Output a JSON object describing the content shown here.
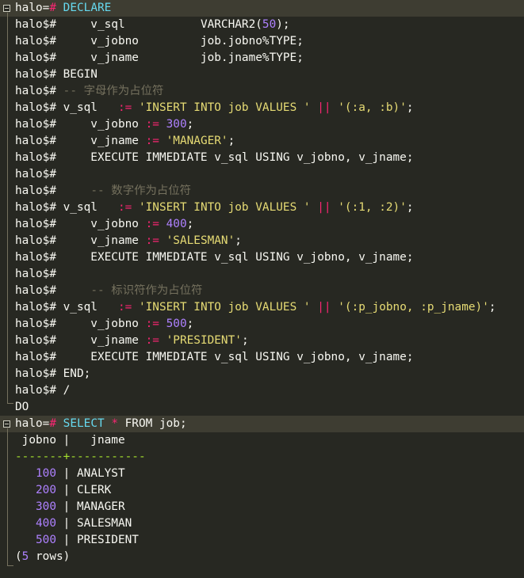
{
  "terminal": {
    "lines": [
      [
        {
          "t": "halo=",
          "c": ""
        },
        {
          "t": "#",
          "c": "op"
        },
        {
          "t": " DECLARE",
          "c": "kw"
        }
      ],
      [
        {
          "t": "halo$#     v_sql           ",
          "c": ""
        },
        {
          "t": "VARCHAR2(",
          "c": ""
        },
        {
          "t": "50",
          "c": "num"
        },
        {
          "t": ");",
          "c": ""
        }
      ],
      [
        {
          "t": "halo$#     v_jobno         job.jobno%TYPE;",
          "c": ""
        }
      ],
      [
        {
          "t": "halo$#     v_jname         job.jname%TYPE;",
          "c": ""
        }
      ],
      [
        {
          "t": "halo$# BEGIN",
          "c": ""
        }
      ],
      [
        {
          "t": "halo$# ",
          "c": ""
        },
        {
          "t": "-- 字母作为占位符",
          "c": "com"
        }
      ],
      [
        {
          "t": "halo$# v_sql   ",
          "c": ""
        },
        {
          "t": ":=",
          "c": "op"
        },
        {
          "t": " ",
          "c": ""
        },
        {
          "t": "'INSERT INTO job VALUES '",
          "c": "str"
        },
        {
          "t": " ",
          "c": ""
        },
        {
          "t": "||",
          "c": "op"
        },
        {
          "t": " ",
          "c": ""
        },
        {
          "t": "'(:a, :b)'",
          "c": "str"
        },
        {
          "t": ";",
          "c": ""
        }
      ],
      [
        {
          "t": "halo$#     v_jobno ",
          "c": ""
        },
        {
          "t": ":=",
          "c": "op"
        },
        {
          "t": " ",
          "c": ""
        },
        {
          "t": "300",
          "c": "num"
        },
        {
          "t": ";",
          "c": ""
        }
      ],
      [
        {
          "t": "halo$#     v_jname ",
          "c": ""
        },
        {
          "t": ":=",
          "c": "op"
        },
        {
          "t": " ",
          "c": ""
        },
        {
          "t": "'MANAGER'",
          "c": "str"
        },
        {
          "t": ";",
          "c": ""
        }
      ],
      [
        {
          "t": "halo$#     EXECUTE IMMEDIATE v_sql USING v_jobno, v_jname;",
          "c": ""
        }
      ],
      [
        {
          "t": "halo$#",
          "c": ""
        }
      ],
      [
        {
          "t": "halo$#     ",
          "c": ""
        },
        {
          "t": "-- 数字作为占位符",
          "c": "com"
        }
      ],
      [
        {
          "t": "halo$# v_sql   ",
          "c": ""
        },
        {
          "t": ":=",
          "c": "op"
        },
        {
          "t": " ",
          "c": ""
        },
        {
          "t": "'INSERT INTO job VALUES '",
          "c": "str"
        },
        {
          "t": " ",
          "c": ""
        },
        {
          "t": "||",
          "c": "op"
        },
        {
          "t": " ",
          "c": ""
        },
        {
          "t": "'(:1, :2)'",
          "c": "str"
        },
        {
          "t": ";",
          "c": ""
        }
      ],
      [
        {
          "t": "halo$#     v_jobno ",
          "c": ""
        },
        {
          "t": ":=",
          "c": "op"
        },
        {
          "t": " ",
          "c": ""
        },
        {
          "t": "400",
          "c": "num"
        },
        {
          "t": ";",
          "c": ""
        }
      ],
      [
        {
          "t": "halo$#     v_jname ",
          "c": ""
        },
        {
          "t": ":=",
          "c": "op"
        },
        {
          "t": " ",
          "c": ""
        },
        {
          "t": "'SALESMAN'",
          "c": "str"
        },
        {
          "t": ";",
          "c": ""
        }
      ],
      [
        {
          "t": "halo$#     EXECUTE IMMEDIATE v_sql USING v_jobno, v_jname;",
          "c": ""
        }
      ],
      [
        {
          "t": "halo$#",
          "c": ""
        }
      ],
      [
        {
          "t": "halo$#     ",
          "c": ""
        },
        {
          "t": "-- 标识符作为占位符",
          "c": "com"
        }
      ],
      [
        {
          "t": "halo$# v_sql   ",
          "c": ""
        },
        {
          "t": ":=",
          "c": "op"
        },
        {
          "t": " ",
          "c": ""
        },
        {
          "t": "'INSERT INTO job VALUES '",
          "c": "str"
        },
        {
          "t": " ",
          "c": ""
        },
        {
          "t": "||",
          "c": "op"
        },
        {
          "t": " ",
          "c": ""
        },
        {
          "t": "'(:p_jobno, :p_jname)'",
          "c": "str"
        },
        {
          "t": ";",
          "c": ""
        }
      ],
      [
        {
          "t": "halo$#     v_jobno ",
          "c": ""
        },
        {
          "t": ":=",
          "c": "op"
        },
        {
          "t": " ",
          "c": ""
        },
        {
          "t": "500",
          "c": "num"
        },
        {
          "t": ";",
          "c": ""
        }
      ],
      [
        {
          "t": "halo$#     v_jname ",
          "c": ""
        },
        {
          "t": ":=",
          "c": "op"
        },
        {
          "t": " ",
          "c": ""
        },
        {
          "t": "'PRESIDENT'",
          "c": "str"
        },
        {
          "t": ";",
          "c": ""
        }
      ],
      [
        {
          "t": "halo$#     EXECUTE IMMEDIATE v_sql USING v_jobno, v_jname;",
          "c": ""
        }
      ],
      [
        {
          "t": "halo$# END;",
          "c": ""
        }
      ],
      [
        {
          "t": "halo$# /",
          "c": ""
        }
      ],
      [
        {
          "t": "DO",
          "c": ""
        }
      ],
      [
        {
          "t": "halo=",
          "c": ""
        },
        {
          "t": "#",
          "c": "op"
        },
        {
          "t": " SELECT ",
          "c": "kw"
        },
        {
          "t": "*",
          "c": "op"
        },
        {
          "t": " FROM job;",
          "c": ""
        }
      ],
      [
        {
          "t": " jobno |   jname",
          "c": ""
        }
      ],
      [
        {
          "t": "-------+-----------",
          "c": "sep"
        }
      ],
      [
        {
          "t": "   ",
          "c": ""
        },
        {
          "t": "100",
          "c": "num"
        },
        {
          "t": " | ANALYST",
          "c": ""
        }
      ],
      [
        {
          "t": "   ",
          "c": ""
        },
        {
          "t": "200",
          "c": "num"
        },
        {
          "t": " | CLERK",
          "c": ""
        }
      ],
      [
        {
          "t": "   ",
          "c": ""
        },
        {
          "t": "300",
          "c": "num"
        },
        {
          "t": " | MANAGER",
          "c": ""
        }
      ],
      [
        {
          "t": "   ",
          "c": ""
        },
        {
          "t": "400",
          "c": "num"
        },
        {
          "t": " | SALESMAN",
          "c": ""
        }
      ],
      [
        {
          "t": "   ",
          "c": ""
        },
        {
          "t": "500",
          "c": "num"
        },
        {
          "t": " | PRESIDENT",
          "c": ""
        }
      ],
      [
        {
          "t": "(",
          "c": ""
        },
        {
          "t": "5",
          "c": "num"
        },
        {
          "t": " rows)",
          "c": ""
        }
      ]
    ]
  },
  "colors": {
    "background": "#272822",
    "text": "#f8f8f2",
    "keyword": "#66d9ef",
    "number": "#ae81ff",
    "string": "#e6db74",
    "operator": "#f92672",
    "comment": "#75715e",
    "separator": "#a6e22e"
  }
}
